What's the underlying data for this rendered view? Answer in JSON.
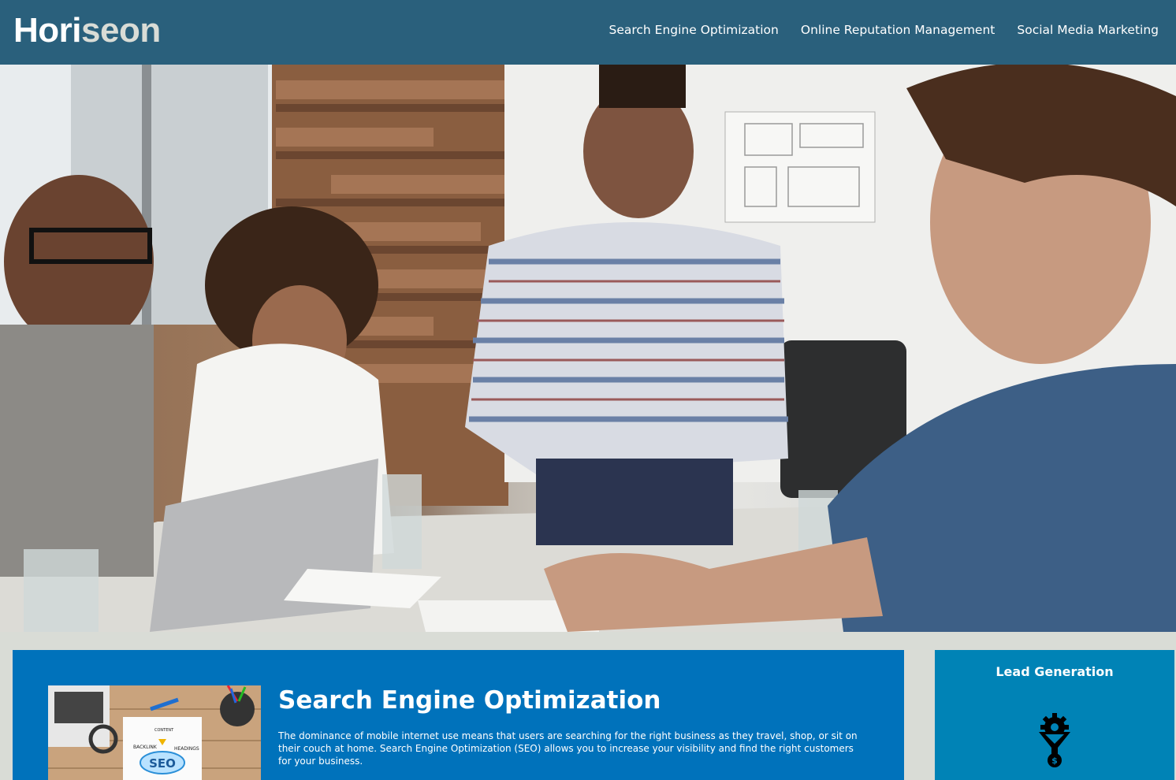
{
  "header": {
    "logo_hori": "Hori",
    "logo_seon": "seon",
    "nav": [
      {
        "label": "Search Engine Optimization"
      },
      {
        "label": "Online Reputation Management"
      },
      {
        "label": "Social Media Marketing"
      }
    ]
  },
  "content": {
    "title": "Search Engine Optimization",
    "body": "The dominance of mobile internet use means that users are searching for the right business as they travel, shop, or sit on their couch at home. Search Engine Optimization (SEO) allows you to increase your visibility and find the right customers for your business.",
    "image_text": {
      "content": "CONTENT",
      "backlink": "BACKLINK",
      "headings": "HEADINGS",
      "seo": "SEO"
    }
  },
  "sidebar": {
    "title": "Lead Generation",
    "icon": "lead-generation-funnel-icon"
  },
  "colors": {
    "header_bg": "#2a607c",
    "page_bg": "#d9dcd6",
    "card_bg": "#0072bb",
    "side_bg": "#0083b6"
  }
}
